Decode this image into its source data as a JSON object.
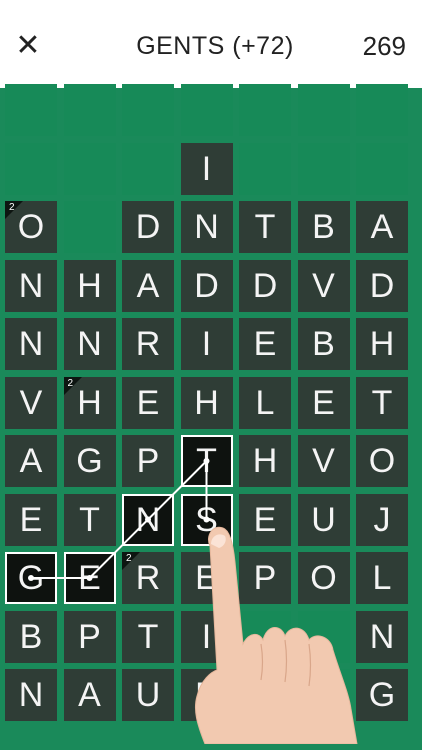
{
  "header": {
    "close_icon": "✕",
    "current_word": "GENTS (+72)",
    "score": "269"
  },
  "board": {
    "rows": [
      [
        "",
        "",
        "",
        "",
        "",
        "",
        ""
      ],
      [
        "",
        "",
        "",
        "I",
        "",
        "",
        ""
      ],
      [
        "O",
        "",
        "D",
        "N",
        "T",
        "B",
        "A"
      ],
      [
        "N",
        "H",
        "A",
        "D",
        "D",
        "V",
        "D"
      ],
      [
        "N",
        "N",
        "R",
        "I",
        "E",
        "B",
        "H"
      ],
      [
        "V",
        "H",
        "E",
        "H",
        "L",
        "E",
        "T"
      ],
      [
        "A",
        "G",
        "P",
        "T",
        "H",
        "V",
        "O"
      ],
      [
        "E",
        "T",
        "N",
        "S",
        "E",
        "U",
        "J"
      ],
      [
        "G",
        "E",
        "R",
        "E",
        "P",
        "O",
        "L"
      ],
      [
        "B",
        "P",
        "T",
        "I",
        "",
        "",
        "N"
      ],
      [
        "N",
        "A",
        "U",
        "E",
        "",
        "",
        "G"
      ]
    ],
    "multipliers": [
      {
        "row": 2,
        "col": 0,
        "value": "2"
      },
      {
        "row": 5,
        "col": 1,
        "value": "2"
      },
      {
        "row": 8,
        "col": 2,
        "value": "2"
      }
    ],
    "selected_path": [
      {
        "row": 8,
        "col": 0
      },
      {
        "row": 8,
        "col": 1
      },
      {
        "row": 7,
        "col": 2
      },
      {
        "row": 6,
        "col": 3
      },
      {
        "row": 7,
        "col": 3
      }
    ]
  },
  "colors": {
    "board_green": "#1a8a5a",
    "tile": "#2f3d36",
    "selected_tile": "#0e120f",
    "hand_skin": "#f2c9b0"
  },
  "icons": {
    "close": "close-icon",
    "hand": "pointing-hand-icon"
  }
}
